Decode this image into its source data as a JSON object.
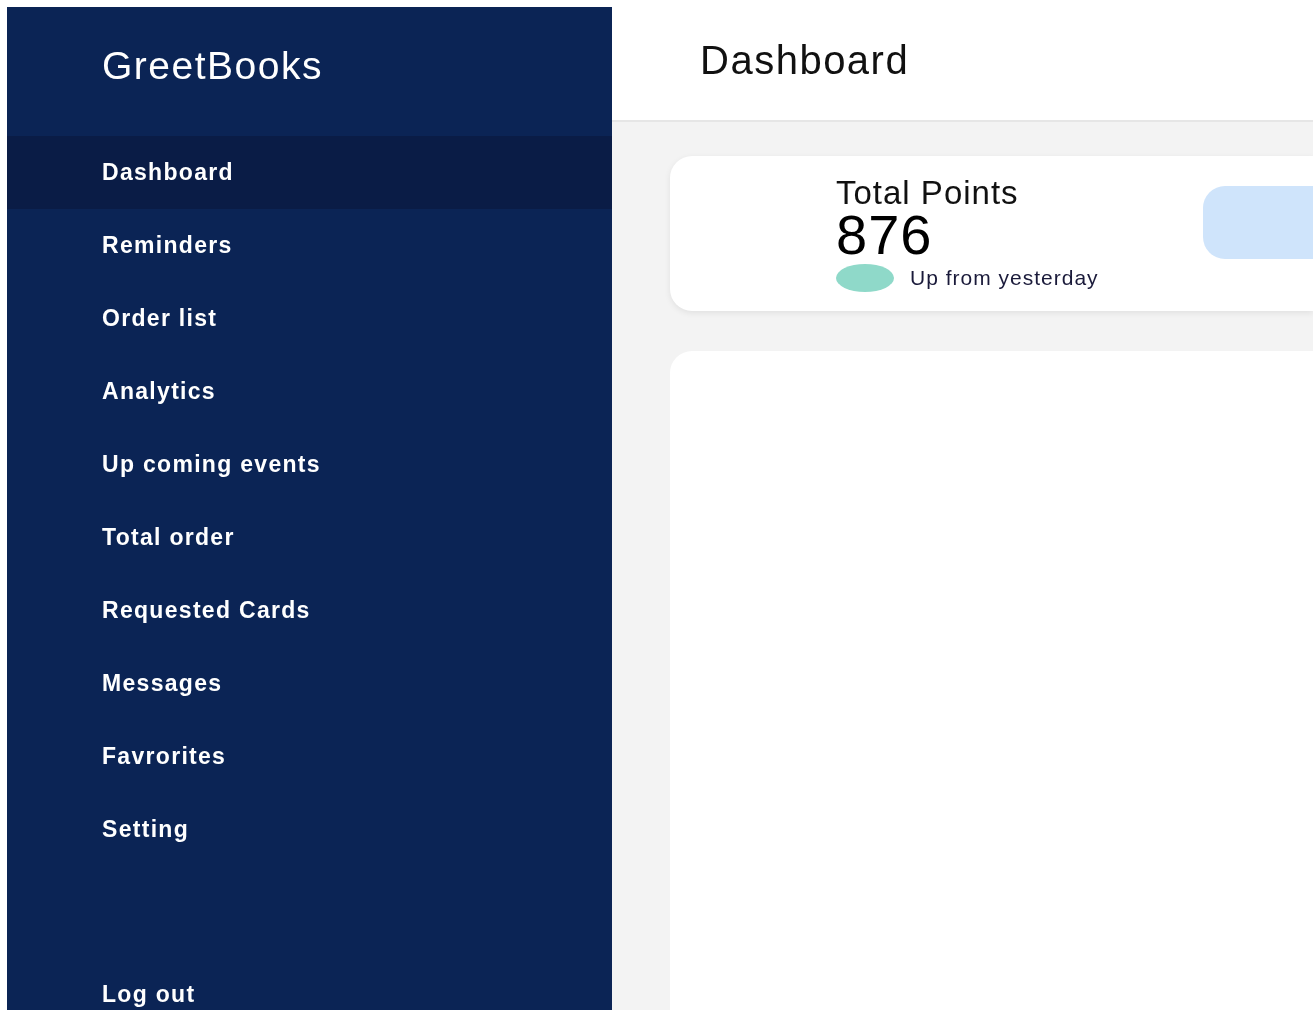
{
  "sidebar": {
    "logo": "GreetBooks",
    "items": [
      {
        "label": "Dashboard",
        "selected": true
      },
      {
        "label": "Reminders",
        "selected": false
      },
      {
        "label": "Order list",
        "selected": false
      },
      {
        "label": "Analytics",
        "selected": false
      },
      {
        "label": "Up coming events",
        "selected": false
      },
      {
        "label": "Total order",
        "selected": false
      },
      {
        "label": "Requested Cards",
        "selected": false
      },
      {
        "label": "Messages",
        "selected": false
      },
      {
        "label": "Favrorites",
        "selected": false
      },
      {
        "label": "Setting",
        "selected": false
      }
    ],
    "logout": "Log out"
  },
  "header": {
    "title": "Dashboard"
  },
  "stat_card": {
    "label": "Total Points",
    "value": "876",
    "trend": "Up from yesterday"
  }
}
